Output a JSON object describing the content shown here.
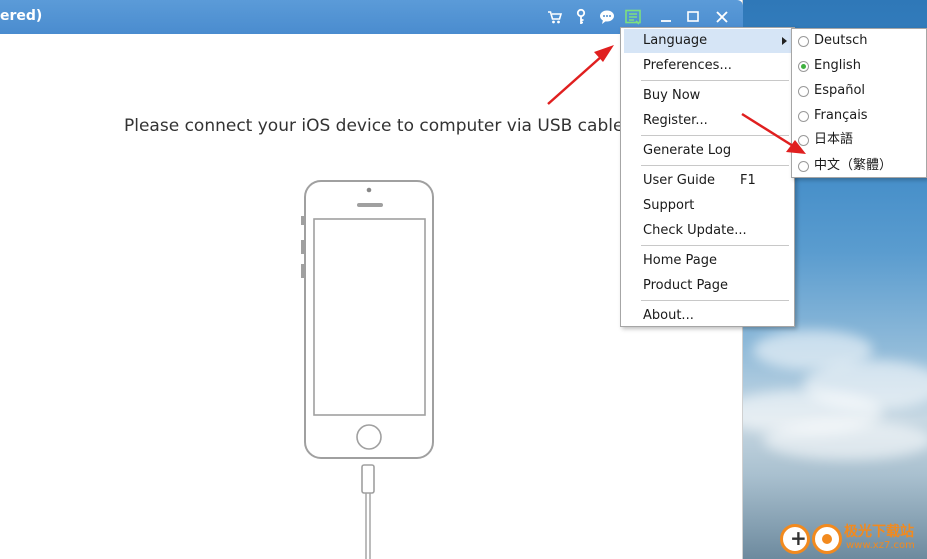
{
  "window": {
    "title": "ered)",
    "titlebar_color": "#4a8ccf"
  },
  "toolbar_icons": [
    "cart-icon",
    "key-icon",
    "chat-icon",
    "menu-list-icon",
    "minimize-icon",
    "maximize-icon",
    "close-icon"
  ],
  "main": {
    "message": "Please connect your iOS device to computer via USB cable"
  },
  "menu": {
    "items": [
      {
        "label": "Language",
        "has_submenu": true
      },
      {
        "label": "Preferences..."
      },
      {
        "label": "Buy Now"
      },
      {
        "label": "Register..."
      },
      {
        "label": "Generate Log"
      },
      {
        "label": "User Guide",
        "shortcut": "F1"
      },
      {
        "label": "Support"
      },
      {
        "label": "Check Update..."
      },
      {
        "label": "Home Page"
      },
      {
        "label": "Product Page"
      },
      {
        "label": "About..."
      }
    ],
    "highlight_color": "#d6e5f6"
  },
  "language_submenu": {
    "items": [
      {
        "label": "Deutsch",
        "selected": false
      },
      {
        "label": "English",
        "selected": true
      },
      {
        "label": "Español",
        "selected": false
      },
      {
        "label": "Français",
        "selected": false
      },
      {
        "label": "日本語",
        "selected": false
      },
      {
        "label": "中文（繁體）",
        "selected": false
      }
    ],
    "selected_color": "#3fb13f"
  },
  "watermark": {
    "line1": "极光下载站",
    "line2": "www.xz7.com",
    "accent": "#f28a1e"
  },
  "annotation_arrow_color": "#e01f1f"
}
